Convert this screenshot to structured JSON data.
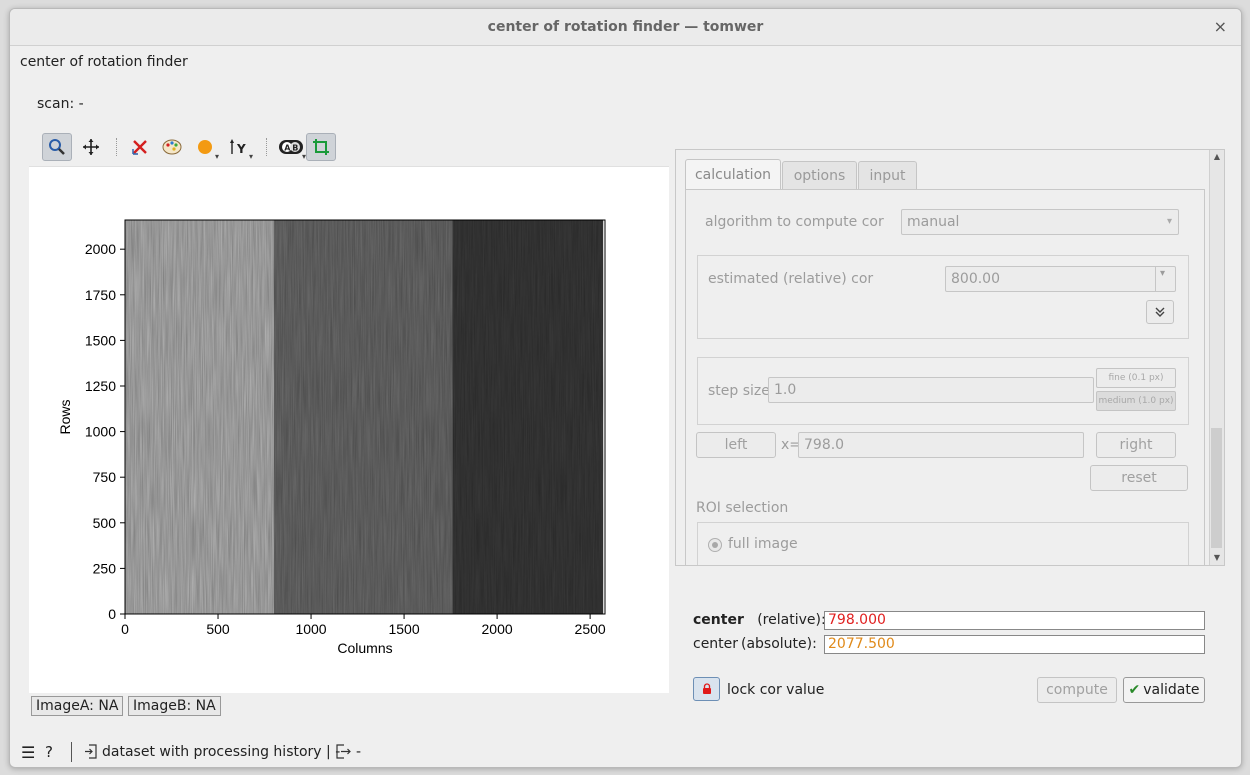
{
  "window": {
    "title": "center of rotation finder — tomwer",
    "close_glyph": "×"
  },
  "header": {
    "title": "center of rotation finder",
    "scan_label": "scan: -"
  },
  "toolbar": {
    "icons": [
      "zoom-icon",
      "pan-icon",
      "reset-zoom-icon",
      "colormap-icon",
      "mask-color-icon",
      "axis-y-icon",
      "compare-icon",
      "crop-icon"
    ]
  },
  "chart_data": {
    "type": "heatmap",
    "title": "",
    "xlabel": "Columns",
    "ylabel": "Rows",
    "xlim": [
      0,
      2580
    ],
    "ylim": [
      0,
      2160
    ],
    "x_ticks": [
      "0",
      "500",
      "1000",
      "1500",
      "2000",
      "2500"
    ],
    "y_ticks": [
      "0",
      "250",
      "500",
      "750",
      "1000",
      "1250",
      "1500",
      "1750",
      "2000"
    ],
    "bands": [
      {
        "x_start": 0,
        "x_end": 800,
        "gray": "#b8b8b8"
      },
      {
        "x_start": 800,
        "x_end": 1760,
        "gray": "#6e6e6e"
      },
      {
        "x_start": 1760,
        "x_end": 2570,
        "gray": "#3b3b3b"
      }
    ]
  },
  "images": {
    "a": "ImageA: NA",
    "b": "ImageB: NA"
  },
  "tabs": [
    {
      "label": "calculation",
      "active": true
    },
    {
      "label": "options",
      "active": false
    },
    {
      "label": "input",
      "active": false
    }
  ],
  "calc": {
    "algorithm_label": "algorithm to compute cor",
    "algorithm_value": "manual",
    "estimated_label": "estimated (relative) cor",
    "estimated_value": "800.00",
    "step_label": "step size",
    "step_value": "1.0",
    "fine_label": "fine (0.1 px)",
    "medium_label": "medium (1.0 px)",
    "left_label": "left",
    "x_prefix": "x=",
    "x_value": "798.0",
    "right_label": "right",
    "reset_label": "reset",
    "roi_label": "ROI selection",
    "full_image_label": "full image"
  },
  "center": {
    "relative_bold": "center",
    "relative_label": "(relative):",
    "relative_value": "798.000",
    "relative_color": "#e02020",
    "absolute_bold": "center",
    "absolute_label": "(absolute):",
    "absolute_value": "2077.500",
    "absolute_color": "#e08a1a"
  },
  "actions": {
    "lock_label": "lock cor value",
    "compute_label": "compute",
    "validate_label": "validate"
  },
  "status": {
    "dataset_label": "dataset with processing history | -",
    "output_label": "-"
  }
}
